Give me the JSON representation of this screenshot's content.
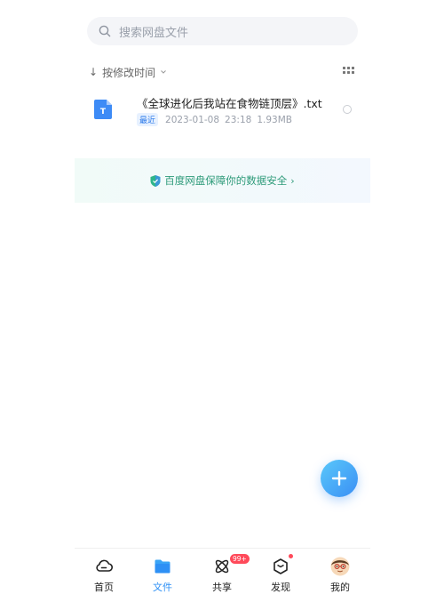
{
  "search": {
    "placeholder": "搜索网盘文件"
  },
  "sort": {
    "arrow": "↓",
    "label": "按修改时间"
  },
  "file": {
    "name": "《全球进化后我站在食物链顶层》.txt",
    "badge": "最近",
    "date": "2023-01-08",
    "time": "23:18",
    "size": "1.93MB"
  },
  "safety": {
    "text": "百度网盘保障你的数据安全",
    "chevron": "›"
  },
  "tabbar": {
    "home": "首页",
    "files": "文件",
    "share": "共享",
    "share_badge": "99+",
    "discover": "发现",
    "mine": "我的"
  },
  "colors": {
    "accent": "#2e90f5",
    "safety": "#2e9b7a",
    "badge": "#ff4a5a"
  }
}
